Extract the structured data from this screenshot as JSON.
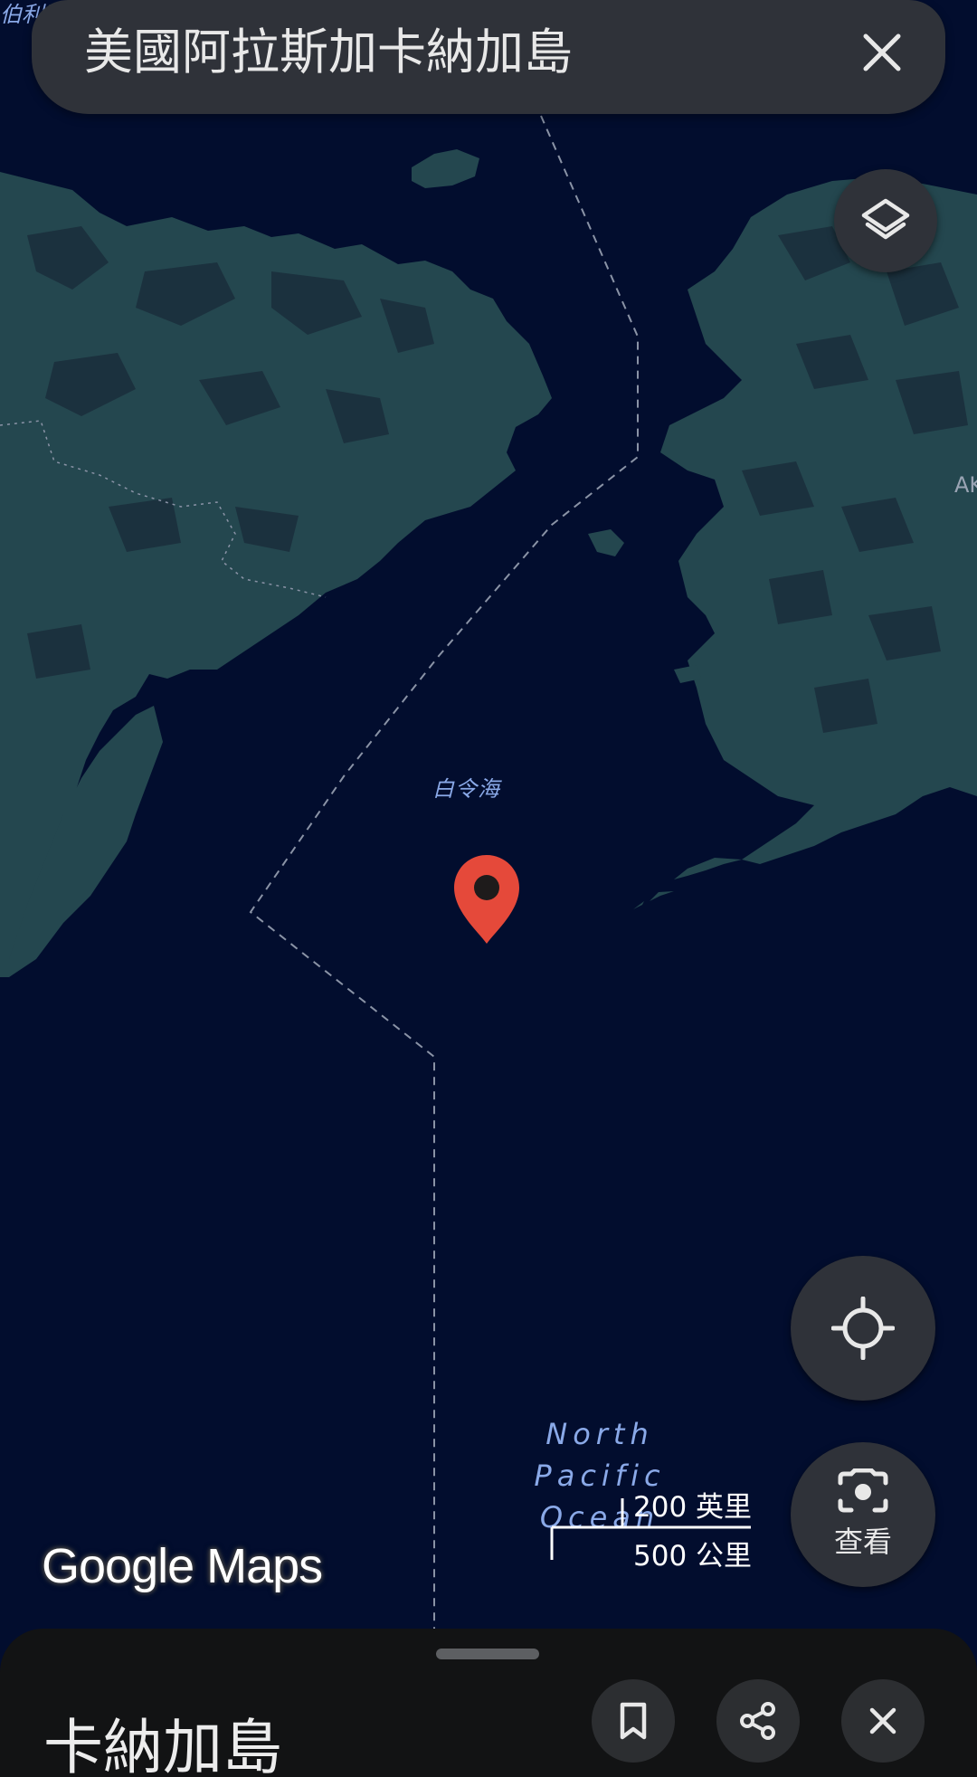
{
  "search": {
    "query": "美國阿拉斯加卡納加島",
    "close_icon": "close-icon"
  },
  "map": {
    "labels": {
      "top_left_partial": "伯利亞",
      "sea": "白令海",
      "ocean": "North Pacific Ocean",
      "right_edge_partial": "AK"
    },
    "marker_icon": "map-pin-icon",
    "colors": {
      "water": "#020d2e",
      "land": "#24474f",
      "land_dark": "#1b2f3c",
      "marker": "#e5493a",
      "boundary": "#8a93a6"
    }
  },
  "controls": {
    "layers_icon": "layers-icon",
    "locate_icon": "my-location-icon",
    "lens_icon": "lens-camera-icon",
    "lens_label": "查看"
  },
  "scale": {
    "miles": "200 英里",
    "km": "500 公里"
  },
  "branding": {
    "logo": "Google Maps"
  },
  "sheet": {
    "title": "卡納加島",
    "save_icon": "bookmark-icon",
    "share_icon": "share-icon",
    "close_icon": "close-icon"
  }
}
